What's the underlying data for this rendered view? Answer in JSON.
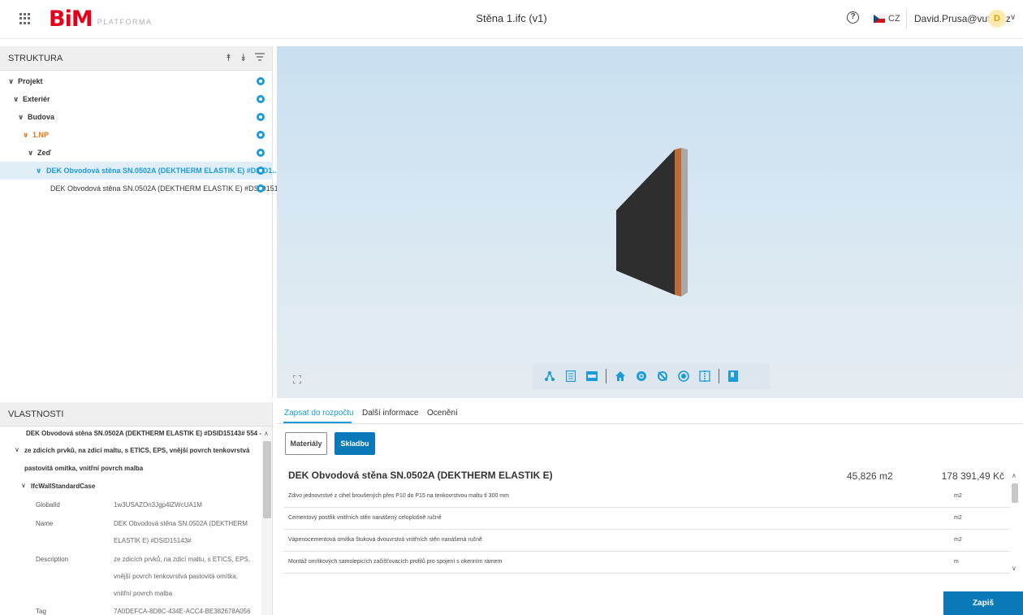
{
  "header": {
    "logo_main": "BiM",
    "logo_sub": "PLATFORMA",
    "document_title": "Stěna 1.ifc (v1)",
    "help_glyph": "?",
    "language": "CZ",
    "user_email": "David.Prusa@vutbr.cz",
    "avatar_initial": "D",
    "icons": [
      "apps-grid-icon",
      "help-icon",
      "cz-flag-icon",
      "chevron-down-icon"
    ]
  },
  "structure": {
    "title": "STRUKTURA",
    "icons": [
      "expand-all-icon",
      "collapse-all-icon",
      "filter-icon"
    ],
    "tree": [
      {
        "label": "Projekt",
        "state": "expanded"
      },
      {
        "label": "Exteriér",
        "state": "expanded"
      },
      {
        "label": "Budova",
        "state": "expanded"
      },
      {
        "label": "1.NP",
        "state": "expanded",
        "highlight": "orange"
      },
      {
        "label": "Zeď",
        "state": "expanded"
      },
      {
        "label": "DEK Obvodová stěna SN.0502A (DEKTHERM ELASTIK E) #DSID1...",
        "state": "expanded",
        "selected": true
      },
      {
        "label": "DEK Obvodová stěna SN.0502A (DEKTHERM ELASTIK E) #DSID151...",
        "state": "leaf"
      }
    ]
  },
  "viewer": {
    "background_top": "#c8dff0",
    "wall_colors": [
      "#2e2e2e",
      "#c06a35",
      "#a8a8a8"
    ],
    "toolbar": [
      "structure-icon",
      "list-icon",
      "ids-icon",
      "home-icon",
      "show-icon",
      "hide-icon",
      "isolate-icon",
      "section-icon",
      "bookmark-icon"
    ]
  },
  "properties": {
    "title": "VLASTNOSTI",
    "heading_line1": "DEK Obvodová stěna SN.0502A (DEKTHERM ELASTIK E) #DSID15143# 554 -",
    "heading_line2": "ze zdicích prvků, na zdicí maltu, s ETICS, EPS, vnější povrch tenkovrstvá",
    "heading_line3": "pastovitá omítka, vnitřní povrch malba",
    "group": "IfcWallStandardCase",
    "rows": [
      {
        "key": "GlobalId",
        "lines": [
          "1w3USAZOn3Jgp4lZWcUA1M"
        ]
      },
      {
        "key": "Name",
        "lines": [
          "DEK Obvodová stěna SN.0502A (DEKTHERM",
          "ELASTIK E) #DSID15143#"
        ]
      },
      {
        "key": "Description",
        "lines": [
          "ze zdicích prvků, na zdicí maltu, s ETICS, EPS,",
          "vnější povrch tenkovrstvá pastovitá omítka,",
          "vnitřní povrch malba"
        ]
      },
      {
        "key": "Tag",
        "lines": [
          "7A0DEFCA-8D8C-434E-ACC4-BE382678A056"
        ]
      }
    ]
  },
  "budget": {
    "tabs": [
      "Zapsat do rozpočtu",
      "Další informace",
      "Ocenění"
    ],
    "active_tab": 0,
    "buttons": {
      "materials": "Materiály",
      "composition": "Skladbu"
    },
    "item": {
      "title": "DEK Obvodová stěna SN.0502A (DEKTHERM ELASTIK E)",
      "quantity": "45,826 m2",
      "price": "178 391,49 Kč"
    },
    "rows": [
      {
        "name": "Zdivo jednovrstvé z cihel broušených přes P10 do P15 na tenkovrstvou maltu tl 300 mm",
        "unit": "m2"
      },
      {
        "name": "Cementový postřik vnitřních stěn nanášený celoplošně ručně",
        "unit": "m2"
      },
      {
        "name": "Vápenocementová omítka štuková dvouvrstvá vnitřních stěn nanášená ručně",
        "unit": "m2"
      },
      {
        "name": "Montáž omítkových samolepicích začišťovacích profilů pro spojení s okenním rámem",
        "unit": "m"
      }
    ],
    "save_label": "Zapiš"
  },
  "colors": {
    "accent": "#1b9bd7",
    "primary_button": "#0a79b7",
    "brand_red": "#e3001b",
    "tree_orange": "#e07818"
  }
}
